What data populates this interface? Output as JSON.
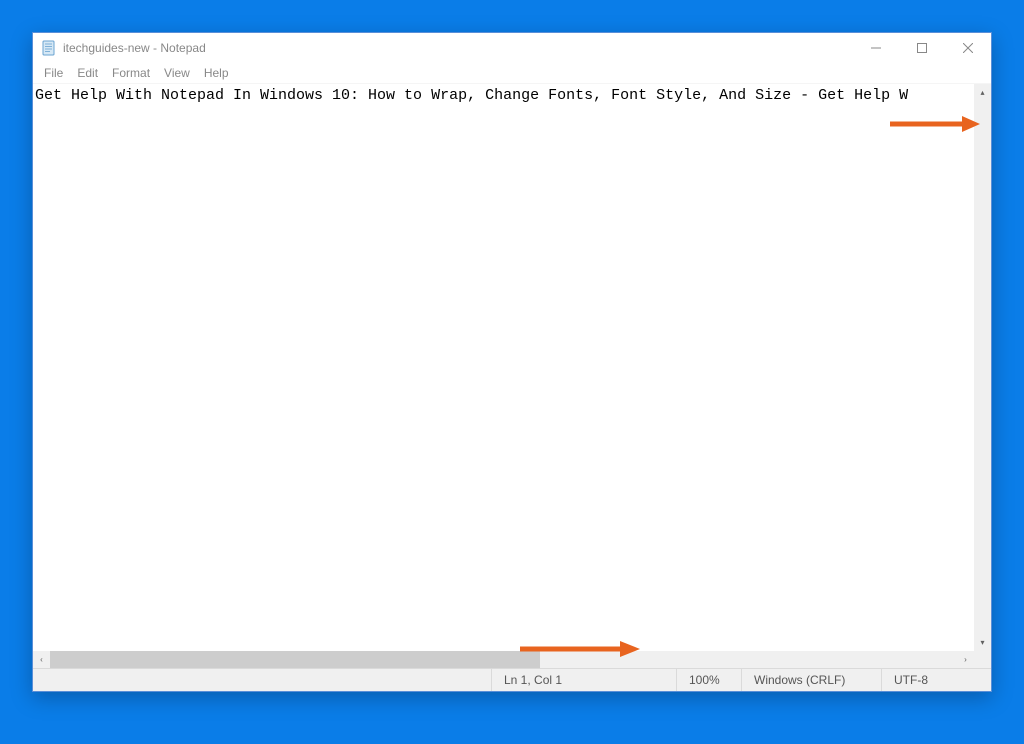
{
  "window": {
    "title": "itechguides-new - Notepad"
  },
  "menu": {
    "items": [
      "File",
      "Edit",
      "Format",
      "View",
      "Help"
    ]
  },
  "editor": {
    "content": "Get Help With Notepad In Windows 10: How to Wrap, Change Fonts, Font Style, And Size - Get Help W"
  },
  "statusbar": {
    "position": "Ln 1, Col 1",
    "zoom": "100%",
    "line_ending": "Windows (CRLF)",
    "encoding": "UTF-8"
  },
  "scroll": {
    "up": "▴",
    "down": "▾",
    "left": "‹",
    "right": "›"
  },
  "annotation": {
    "arrow_color": "#e8641f"
  }
}
